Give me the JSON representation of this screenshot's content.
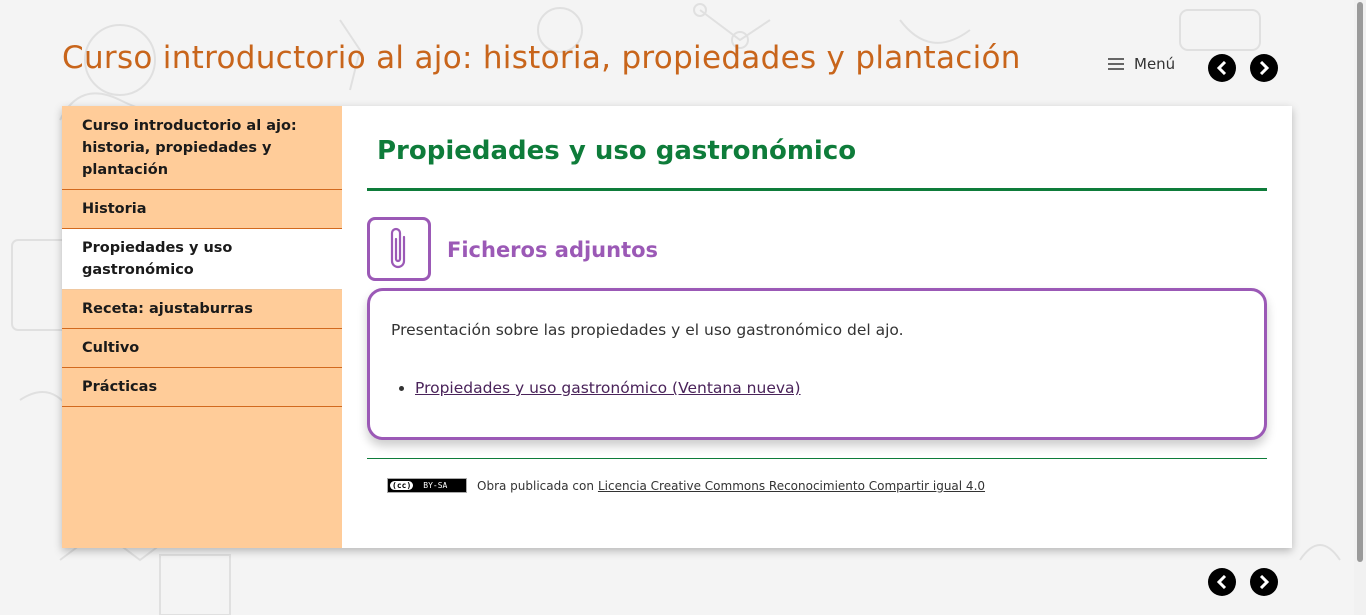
{
  "site": {
    "title": "Curso introductorio al ajo: historia, propiedades y plantación",
    "menu_label": "Menú"
  },
  "sidebar": {
    "items": [
      {
        "label": "Curso introductorio al ajo: historia, propiedades y plantación"
      },
      {
        "label": "Historia"
      },
      {
        "label": "Propiedades y uso gastronómico"
      },
      {
        "label": "Receta: ajustaburras"
      },
      {
        "label": "Cultivo"
      },
      {
        "label": "Prácticas"
      }
    ],
    "active_index": 2
  },
  "main": {
    "page_title": "Propiedades y uso gastronómico",
    "attachments": {
      "heading": "Ficheros adjuntos",
      "description": "Presentación sobre las propiedades y el uso gastronómico del ajo.",
      "link_label": "Propiedades y uso gastronómico (Ventana nueva)"
    },
    "license": {
      "badge_cc": "(cc)",
      "badge_text": "BY-SA",
      "prefix": "Obra publicada con",
      "link_label": "Licencia Creative Commons Reconocimiento Compartir igual 4.0"
    }
  },
  "icons": {
    "prev": "chevron-left-icon",
    "next": "chevron-right-icon",
    "menu": "hamburger-icon",
    "attachment": "paperclip-icon"
  },
  "colors": {
    "site_title": "#c8651b",
    "sidebar_bg": "#ffcc99",
    "sidebar_border": "#d2691e",
    "page_title": "#0e7c3a",
    "attachment_accent": "#9b59b6"
  }
}
